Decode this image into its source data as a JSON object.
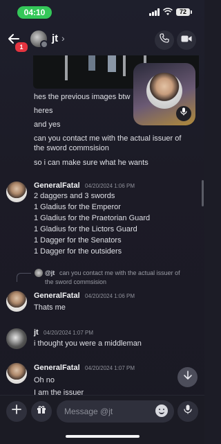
{
  "status": {
    "time": "04:10",
    "battery": "72"
  },
  "header": {
    "unread_badge": "1",
    "name": "jt",
    "chevron": "›"
  },
  "messages_top": [
    "hes the previous images btw",
    "heres",
    "and yes",
    "can you contact me with the actual issuer of",
    "the sword commsision",
    "so i can make sure what he wants"
  ],
  "group1": {
    "user": "GeneralFatal",
    "time": "04/20/2024 1:06 PM",
    "lines": [
      "2 daggers and 3 swords",
      "1 Gladius for the Emperor",
      "1 Gladius for the Praetorian Guard",
      "1 Gladius for the Lictors Guard",
      "1 Dagger for the Senators",
      "1 Dagger for the outsiders"
    ]
  },
  "reply": {
    "name": "@jt",
    "text_line1": "can you contact me with the actual issuer of",
    "text_line2": "the sword commsision"
  },
  "group2": {
    "user": "GeneralFatal",
    "time": "04/20/2024 1:06 PM",
    "text": "Thats me"
  },
  "group3": {
    "user": "jt",
    "time": "04/20/2024 1:07 PM",
    "text": "i thought you were a middleman"
  },
  "group4": {
    "user": "GeneralFatal",
    "time": "04/20/2024 1:07 PM",
    "line1": "Oh no",
    "line2": "I am the issuer"
  },
  "input": {
    "placeholder": "Message @jt"
  },
  "icons": {
    "back": "arrow-left-icon",
    "call": "phone-icon",
    "video": "video-camera-icon",
    "add": "plus-icon",
    "gift": "gift-icon",
    "emoji": "emoji-icon",
    "mic": "microphone-icon",
    "jump": "arrow-down-icon"
  },
  "colors": {
    "accent_green": "#34c759",
    "badge_red": "#e5343f",
    "background": "#1c1c26"
  }
}
